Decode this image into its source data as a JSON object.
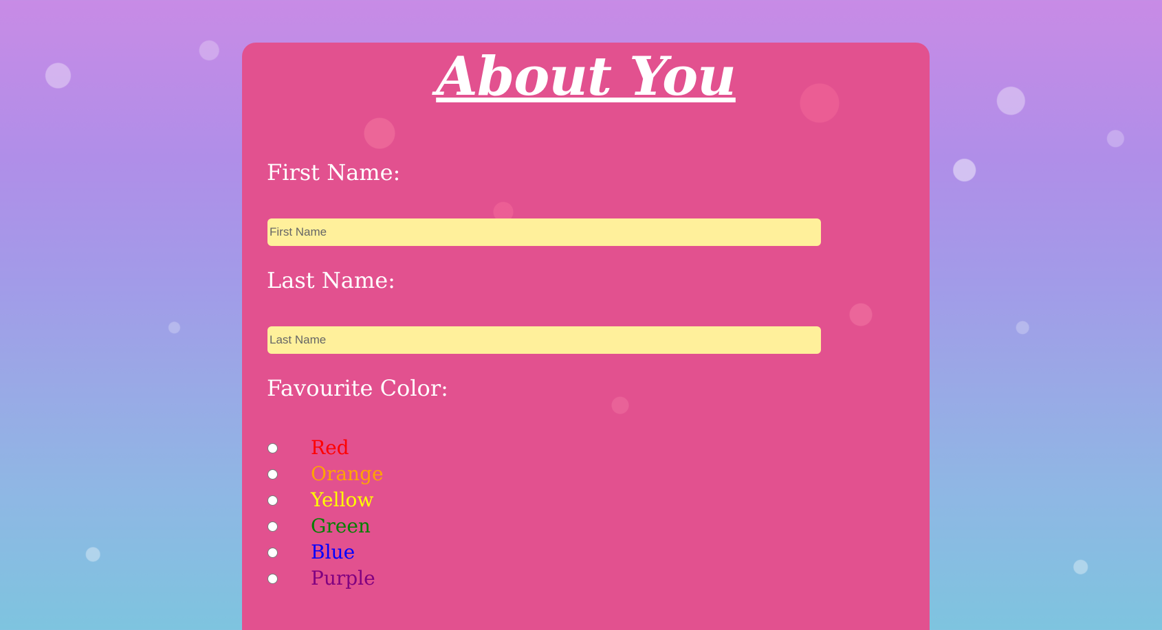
{
  "form": {
    "title": "About You",
    "first_name": {
      "label": "First Name:",
      "placeholder": "First Name",
      "value": ""
    },
    "last_name": {
      "label": "Last Name:",
      "placeholder": "Last Name",
      "value": ""
    },
    "favourite_color": {
      "label": "Favourite Color:",
      "options": [
        {
          "label": "Red",
          "color": "#ff0000",
          "checked": false
        },
        {
          "label": "Orange",
          "color": "#ffa500",
          "checked": false
        },
        {
          "label": "Yellow",
          "color": "#ffff00",
          "checked": false
        },
        {
          "label": "Green",
          "color": "#008000",
          "checked": false
        },
        {
          "label": "Blue",
          "color": "#0000ff",
          "checked": false
        },
        {
          "label": "Purple",
          "color": "#800080",
          "checked": false
        }
      ]
    }
  },
  "colors": {
    "card_background": "#e2518f",
    "input_background": "#fff09b",
    "text": "#ffffff"
  }
}
